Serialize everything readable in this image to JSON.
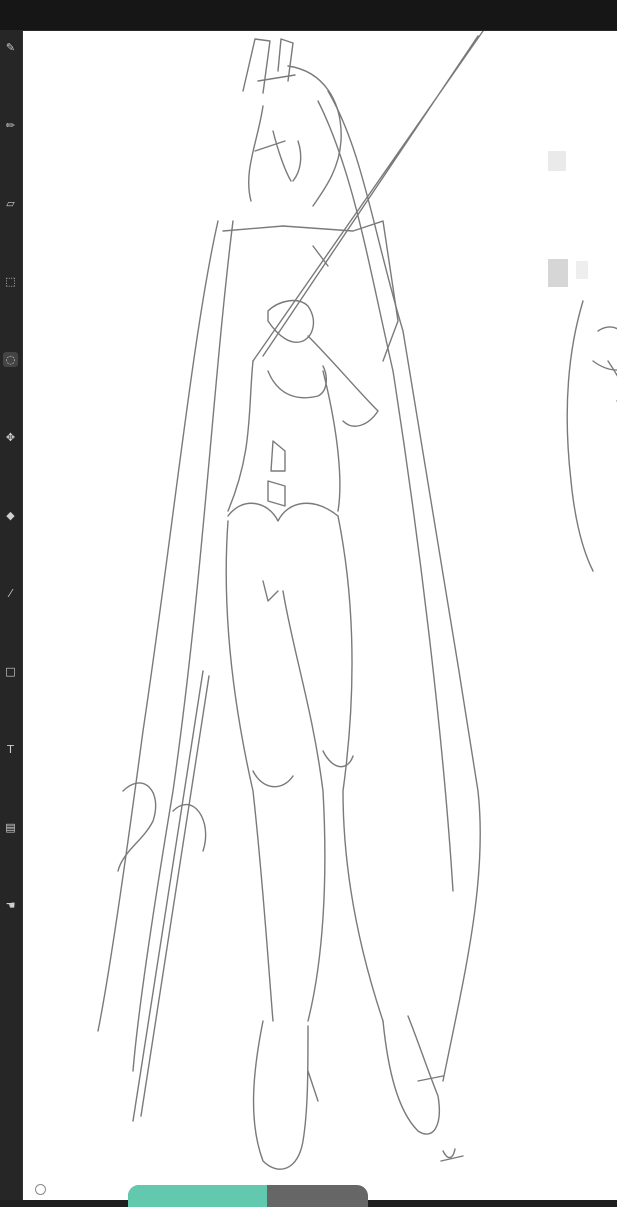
{
  "toolbar": {
    "tools": [
      {
        "icon": "brush-icon",
        "glyph": "✎"
      },
      {
        "icon": "pencil-icon",
        "glyph": "✏"
      },
      {
        "icon": "eraser-icon",
        "glyph": "▱"
      },
      {
        "icon": "selection-icon",
        "glyph": "⬚"
      },
      {
        "icon": "lasso-icon",
        "glyph": "◌"
      },
      {
        "icon": "move-icon",
        "glyph": "✥"
      },
      {
        "icon": "fill-icon",
        "glyph": "◆"
      },
      {
        "icon": "eyedropper-icon",
        "glyph": "⁄"
      },
      {
        "icon": "shape-icon",
        "glyph": "□"
      },
      {
        "icon": "text-icon",
        "glyph": "T"
      },
      {
        "icon": "gradient-icon",
        "glyph": "▤"
      },
      {
        "icon": "hand-icon",
        "glyph": "☚"
      }
    ],
    "active_index": 4
  },
  "status": {
    "progress_percent": 58
  },
  "colors": {
    "accent": "#62c9ae",
    "chrome": "#1e1e1e",
    "canvas": "#ffffff",
    "sketch_stroke": "#7a7a7a"
  }
}
